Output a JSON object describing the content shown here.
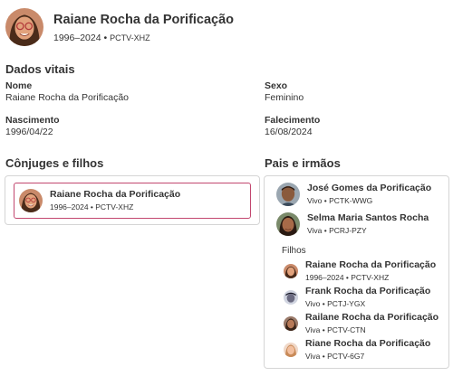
{
  "person": {
    "name": "Raiane Rocha da Porificação",
    "years": "1996–2024",
    "pid": "PCTV-XHZ"
  },
  "vital": {
    "title": "Dados vitais",
    "name_label": "Nome",
    "name_value": "Raiane Rocha da Porificação",
    "sex_label": "Sexo",
    "sex_value": "Feminino",
    "birth_label": "Nascimento",
    "birth_value": "1996/04/22",
    "death_label": "Falecimento",
    "death_value": "16/08/2024"
  },
  "spouses": {
    "title": "Cônjuges e filhos",
    "person": {
      "name": "Raiane Rocha da Porificação",
      "meta": "1996–2024 • PCTV-XHZ"
    }
  },
  "parents": {
    "title": "Pais e irmãos",
    "father": {
      "name": "José Gomes da Porificação",
      "meta": "Vivo • PCTK-WWG"
    },
    "mother": {
      "name": "Selma Maria Santos Rocha",
      "meta": "Viva • PCRJ-PZY"
    },
    "children_label": "Filhos",
    "children": [
      {
        "name": "Raiane Rocha da Porificação",
        "meta": "1996–2024 • PCTV-XHZ"
      },
      {
        "name": "Frank Rocha da Porificação",
        "meta": "Vivo • PCTJ-YGX"
      },
      {
        "name": "Railane Rocha da Porificação",
        "meta": "Viva • PCTV-CTN"
      },
      {
        "name": "Riane Rocha da Porificação",
        "meta": "Viva • PCTV-6G7"
      }
    ]
  }
}
